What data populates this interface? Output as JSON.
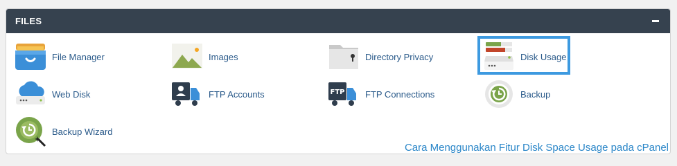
{
  "section": {
    "title": "FILES",
    "collapse_icon": "minus-icon"
  },
  "items": [
    {
      "id": "file-manager",
      "label": "File Manager",
      "icon": "file-manager-icon"
    },
    {
      "id": "images",
      "label": "Images",
      "icon": "images-icon"
    },
    {
      "id": "directory-privacy",
      "label": "Directory Privacy",
      "icon": "directory-privacy-icon"
    },
    {
      "id": "disk-usage",
      "label": "Disk Usage",
      "icon": "disk-usage-icon"
    },
    {
      "id": "web-disk",
      "label": "Web Disk",
      "icon": "web-disk-icon"
    },
    {
      "id": "ftp-accounts",
      "label": "FTP Accounts",
      "icon": "ftp-accounts-icon"
    },
    {
      "id": "ftp-connections",
      "label": "FTP Connections",
      "icon": "ftp-connections-icon"
    },
    {
      "id": "backup",
      "label": "Backup",
      "icon": "backup-icon"
    },
    {
      "id": "backup-wizard",
      "label": "Backup Wizard",
      "icon": "backup-wizard-icon"
    }
  ],
  "caption": "Cara Menggunakan Fitur Disk Space Usage pada cPanel",
  "colors": {
    "header_bg": "#36424f",
    "link": "#2a5a8a",
    "highlight": "#3d9ae0",
    "caption": "#2a86c8"
  }
}
